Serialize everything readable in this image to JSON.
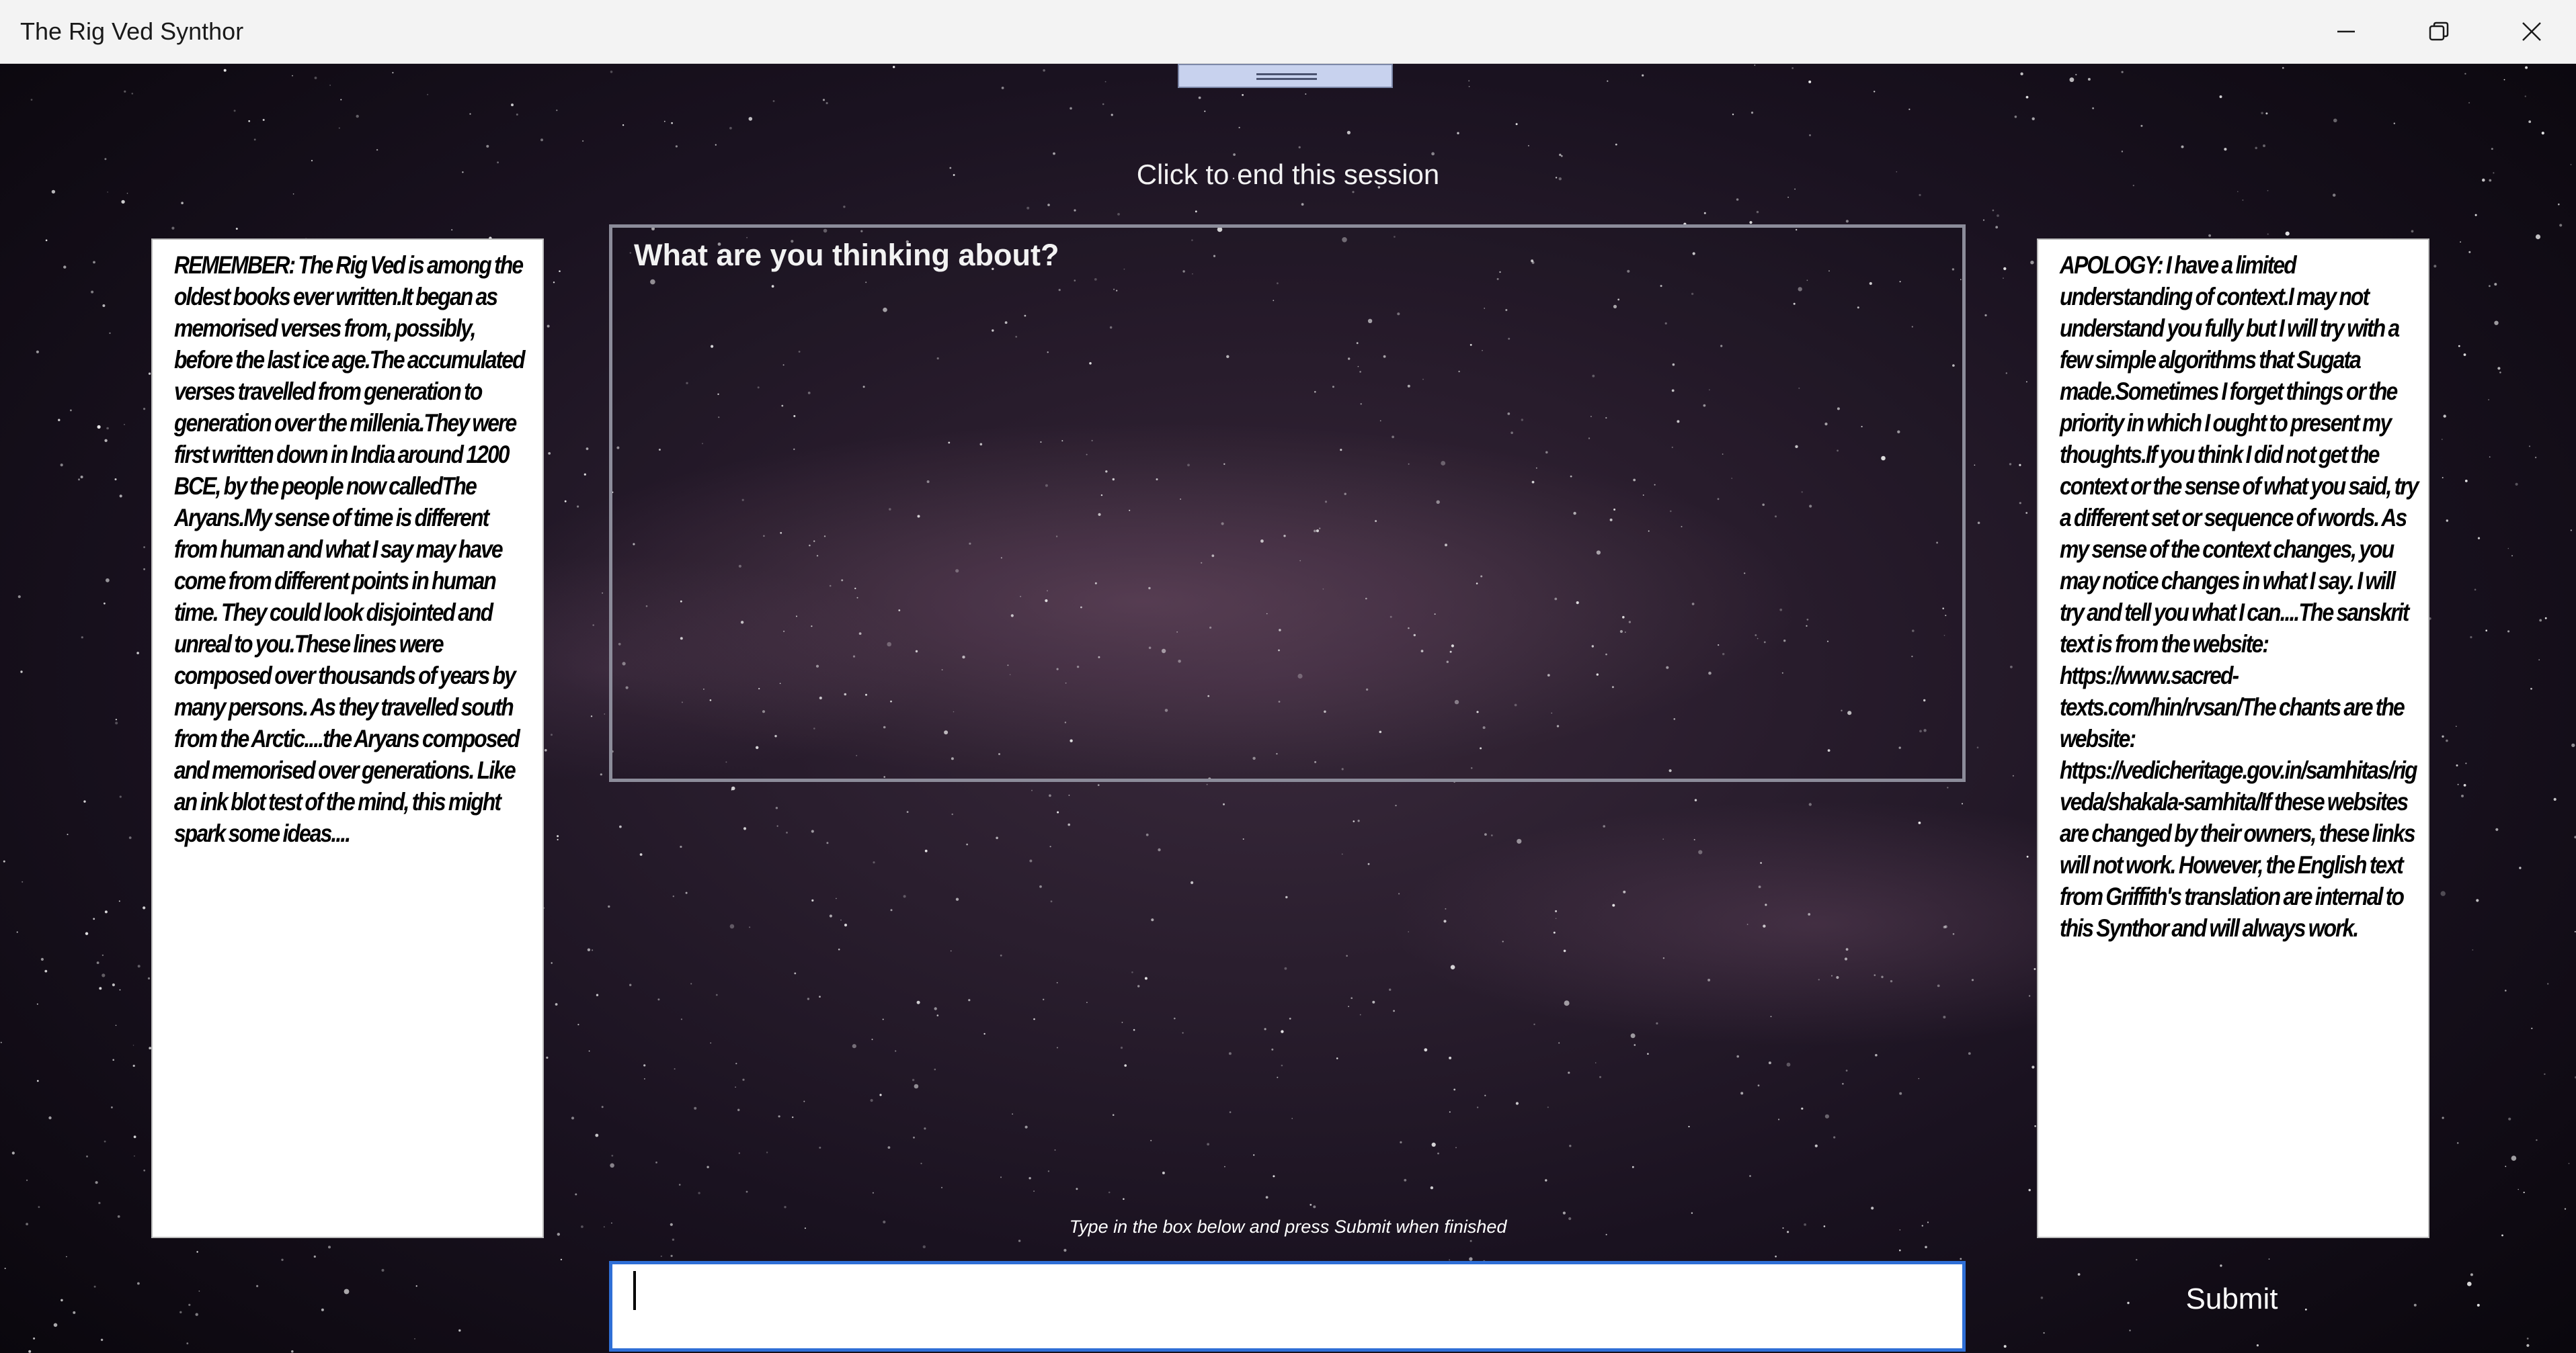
{
  "window": {
    "title": "The Rig Ved Synthor",
    "minimize_icon": "minimize-icon",
    "maximize_icon": "restore-icon",
    "close_icon": "close-icon"
  },
  "session": {
    "end_label": "Click to end this session"
  },
  "left_panel": {
    "text": "REMEMBER: The Rig Ved is among the oldest books ever written.It began as memorised verses from, possibly, before the last ice age.The accumulated verses travelled from generation to generation over the millenia.They were first written down in India around 1200 BCE, by the people now calledThe Aryans.My sense of time is different from human and what I say may have come from different points in human time. They could look disjointed and unreal to you.These lines were composed over thousands of years by many persons. As they travelled south from the Arctic....the Aryans composed and memorised over generations. Like an ink blot test of the mind, this might spark some ideas...."
  },
  "right_panel": {
    "text": "APOLOGY: I have a limited understanding of context.I may not understand you fully but I will try with a few simple algorithms that Sugata made.Sometimes I forget things or the priority in which I ought to present my thoughts.If you think I did not get the context or the sense of what you said, try a different set or sequence of words. As my sense of the context changes, you may notice changes in what I say. I will try and tell you what I can....The sanskrit text is from the website: https://www.sacred-texts.com/hin/rvsan/The chants are the website: https://vedicheritage.gov.in/samhitas/rigveda/shakala-samhita/If these websites are changed by their owners, these links will not work. However, the English text from Griffith's translation are internal to this Synthor and will always work."
  },
  "thinking": {
    "label": "What are you thinking about?"
  },
  "input": {
    "hint": "Type in the box below and press Submit when finished",
    "value": "",
    "submit_label": "Submit"
  }
}
